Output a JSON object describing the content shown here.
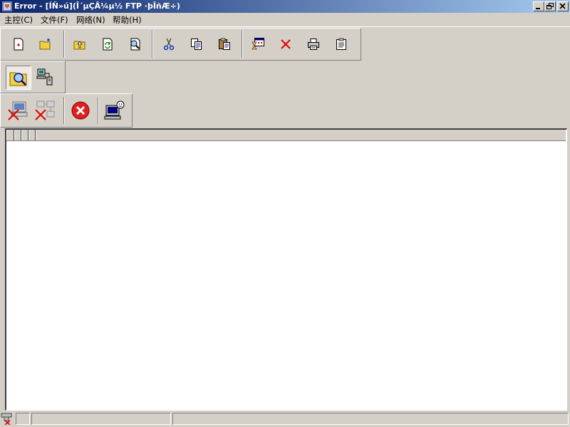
{
  "window": {
    "title": "Error - [ÍÑ»ú](Î´µÇÂ¼µ½ FTP ·þÎñÆ÷)",
    "title_color": "#0a246a"
  },
  "menu": {
    "items": [
      {
        "label": "主控(C)"
      },
      {
        "label": "文件(F)"
      },
      {
        "label": "网络(N)"
      },
      {
        "label": "帮助(H)"
      }
    ]
  },
  "toolbar_main": {
    "buttons": [
      {
        "icon": "new-file-icon"
      },
      {
        "icon": "new-folder-icon"
      },
      {
        "icon": "folder-up-icon"
      },
      {
        "icon": "refresh-icon"
      },
      {
        "icon": "find-icon"
      },
      {
        "icon": "cut-icon"
      },
      {
        "icon": "copy-icon"
      },
      {
        "icon": "paste-icon"
      },
      {
        "icon": "schedule-icon"
      },
      {
        "icon": "delete-icon"
      },
      {
        "icon": "print-icon"
      },
      {
        "icon": "properties-icon"
      }
    ]
  },
  "toolbar_view": {
    "buttons": [
      {
        "icon": "explore-folder-icon",
        "pressed": true
      },
      {
        "icon": "network-tree-icon"
      }
    ]
  },
  "toolbar_connect": {
    "buttons": [
      {
        "icon": "disconnect-computer-icon"
      },
      {
        "icon": "disconnect-network-icon"
      },
      {
        "icon": "stop-icon"
      },
      {
        "icon": "remote-user-icon"
      }
    ]
  },
  "status": {
    "icon": "offline-status-icon",
    "panes": [
      "",
      "",
      ""
    ]
  }
}
